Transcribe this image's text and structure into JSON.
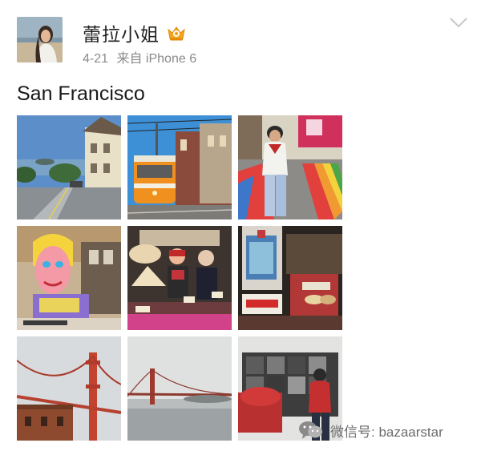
{
  "post": {
    "author": "蕾拉小姐",
    "date": "4-21",
    "source": "来自 iPhone 6",
    "text": "San Francisco",
    "photos": [
      {
        "name": "photo-street-hill"
      },
      {
        "name": "photo-cable-car"
      },
      {
        "name": "photo-rainbow-crosswalk"
      },
      {
        "name": "photo-pop-art"
      },
      {
        "name": "photo-chinatown-shop"
      },
      {
        "name": "photo-shop-window"
      },
      {
        "name": "photo-golden-gate-fort"
      },
      {
        "name": "photo-golden-gate-fog"
      },
      {
        "name": "photo-mural-wall"
      }
    ]
  },
  "watermark": {
    "text": "微信号: bazaarstar"
  },
  "icons": {
    "badge": "vip-crown-icon",
    "menu": "chevron-down-icon",
    "wechat": "wechat-icon"
  },
  "colors": {
    "badge_orange": "#f2a51a",
    "meta_gray": "#8a8a8a",
    "chevron_gray": "#c8c8c8"
  }
}
